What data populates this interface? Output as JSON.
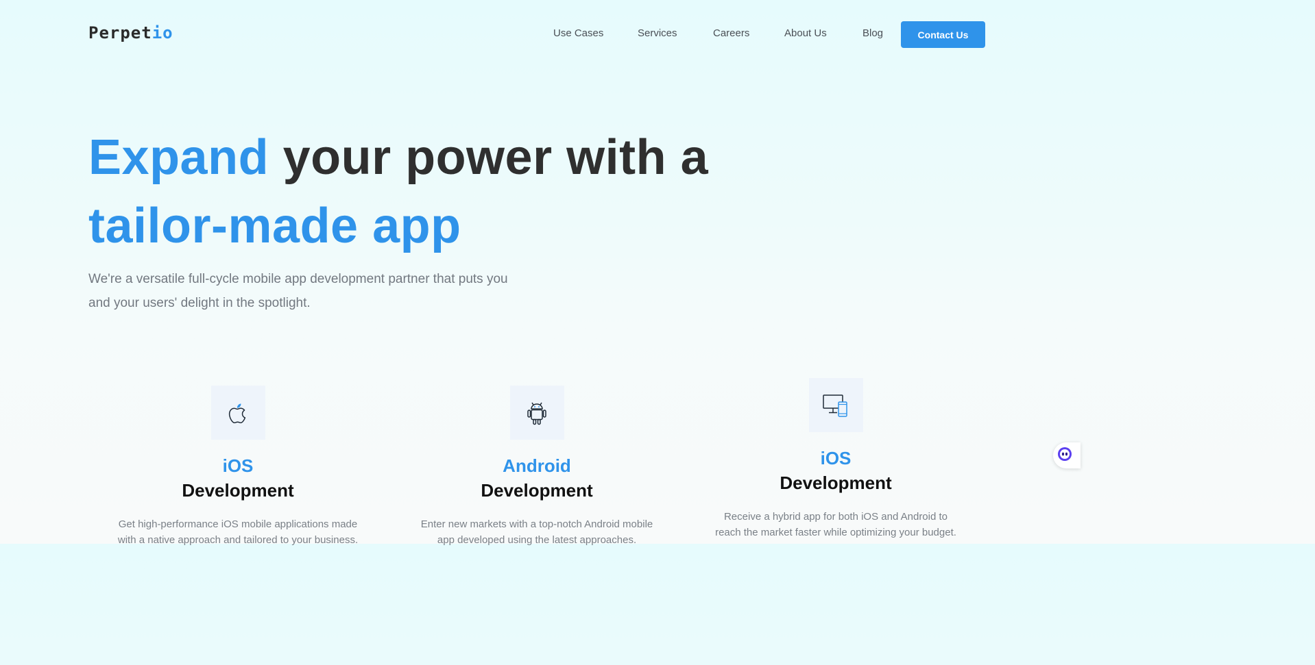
{
  "header": {
    "logo_main": "Perpet",
    "logo_accent": "io",
    "nav": [
      "Use Cases",
      "Services",
      "Careers",
      "About Us",
      "Blog"
    ],
    "contact_label": "Contact Us"
  },
  "hero": {
    "title_blue_1": "Expand",
    "title_dark": " your power with a",
    "title_blue_2": "tailor-made app",
    "subtitle": "We're a versatile full-cycle mobile app development partner that puts you and your users' delight in the spotlight."
  },
  "services": [
    {
      "icon": "apple-icon",
      "title_1": "iOS",
      "title_2": "Development",
      "desc": "Get high-performance iOS mobile applications made with a native approach and tailored to your business."
    },
    {
      "icon": "android-icon",
      "title_1": "Android",
      "title_2": "Development",
      "desc": "Enter new markets with a top-notch Android mobile app developed using the latest approaches."
    },
    {
      "icon": "devices-icon",
      "title_1": "iOS",
      "title_2": "Development",
      "desc": "Receive a hybrid app for both iOS and Android to reach the market faster while optimizing your budget."
    }
  ],
  "chat_widget": {
    "icon": "chat-bot-icon"
  },
  "colors": {
    "accent": "#2f93ea",
    "text_dark": "#2f2f2f",
    "text_muted": "#727880"
  }
}
